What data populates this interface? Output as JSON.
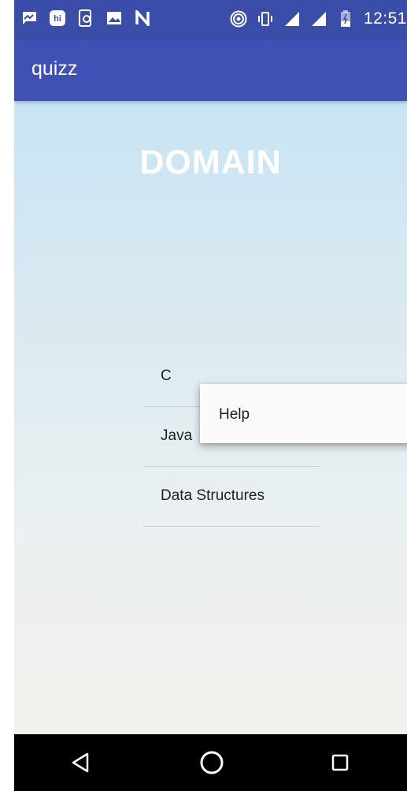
{
  "status_bar": {
    "time": "12:51",
    "left_icons": [
      "message-icon",
      "hike-icon",
      "phone-sync-icon",
      "image-icon",
      "n-logo-icon"
    ],
    "right_icons": [
      "hotspot-icon",
      "vibrate-icon",
      "signal-icon",
      "signal-icon",
      "battery-icon"
    ]
  },
  "app_bar": {
    "title": "quizz"
  },
  "main": {
    "heading": "DOMAIN",
    "domains": [
      {
        "label": "C"
      },
      {
        "label": "Java"
      },
      {
        "label": "Data Structures"
      }
    ]
  },
  "popup_menu": {
    "items": [
      {
        "label": "Help"
      }
    ]
  },
  "nav_bar": {
    "buttons": [
      "back-icon",
      "home-icon",
      "recents-icon"
    ]
  },
  "colors": {
    "status_bar": "#3a4da8",
    "app_bar": "#3f51b5",
    "heading": "#ffffff",
    "nav_bar": "#000000"
  }
}
